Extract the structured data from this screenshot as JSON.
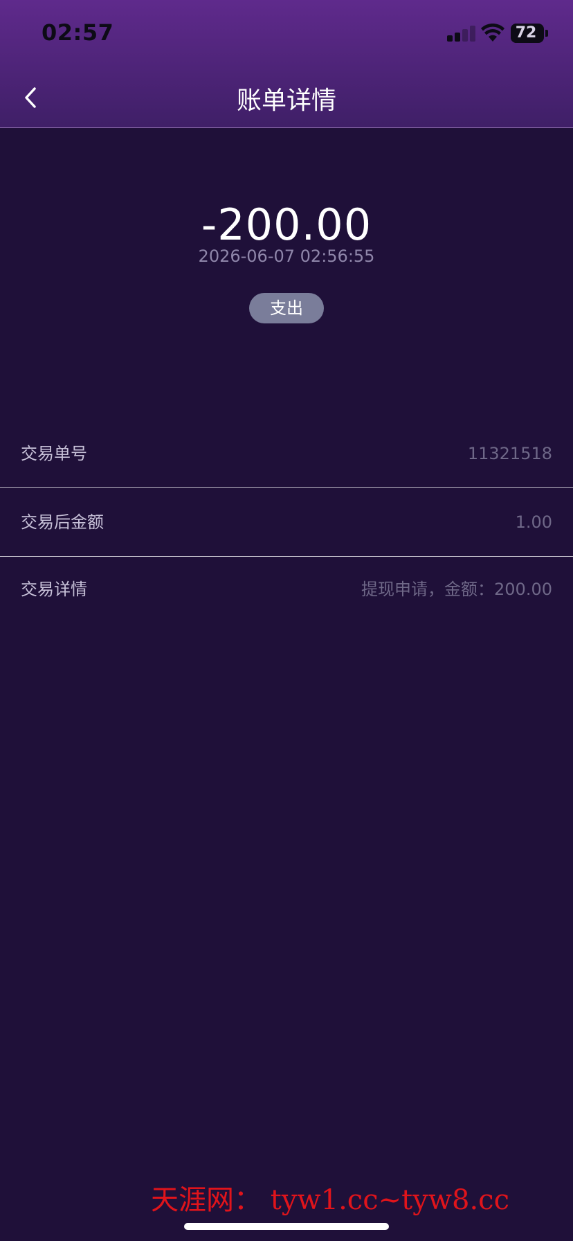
{
  "status_bar": {
    "time": "02:57",
    "battery": "72",
    "signal_bars_active": 2
  },
  "nav": {
    "title": "账单详情",
    "back_icon": "chevron-left-icon"
  },
  "transaction": {
    "amount": "-200.00",
    "datetime": "2026-06-07 02:56:55",
    "type_label": "支出"
  },
  "details": [
    {
      "label": "交易单号",
      "value": "11321518"
    },
    {
      "label": "交易后金额",
      "value": "1.00"
    },
    {
      "label": "交易详情",
      "value": "提现申请，金额：200.00"
    }
  ],
  "watermark": "天涯网：  tyw1.cc~tyw8.cc",
  "colors": {
    "background": "#1f1039",
    "header_top": "#5f2a8c",
    "badge": "#7a7d9a",
    "watermark": "#e0141b"
  }
}
